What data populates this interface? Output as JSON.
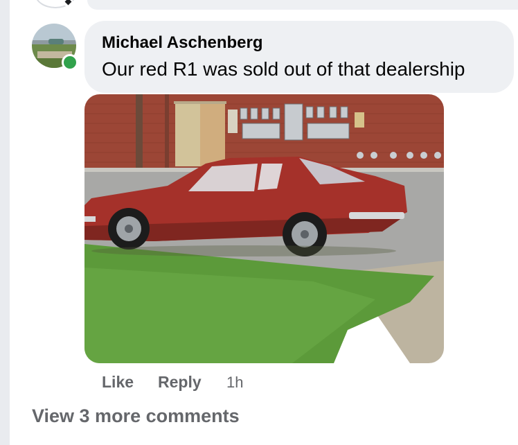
{
  "comment": {
    "author": "Michael Aschenberg",
    "text": "Our red R1 was sold out of that dealership",
    "author_online": true,
    "attachment": "photo",
    "actions": {
      "like": "Like",
      "reply": "Reply",
      "time": "1h"
    }
  },
  "view_more": "View 3 more comments",
  "colors": {
    "bubble": "#eef0f3",
    "secondary_text": "#65676b",
    "online": "#31a24c"
  }
}
